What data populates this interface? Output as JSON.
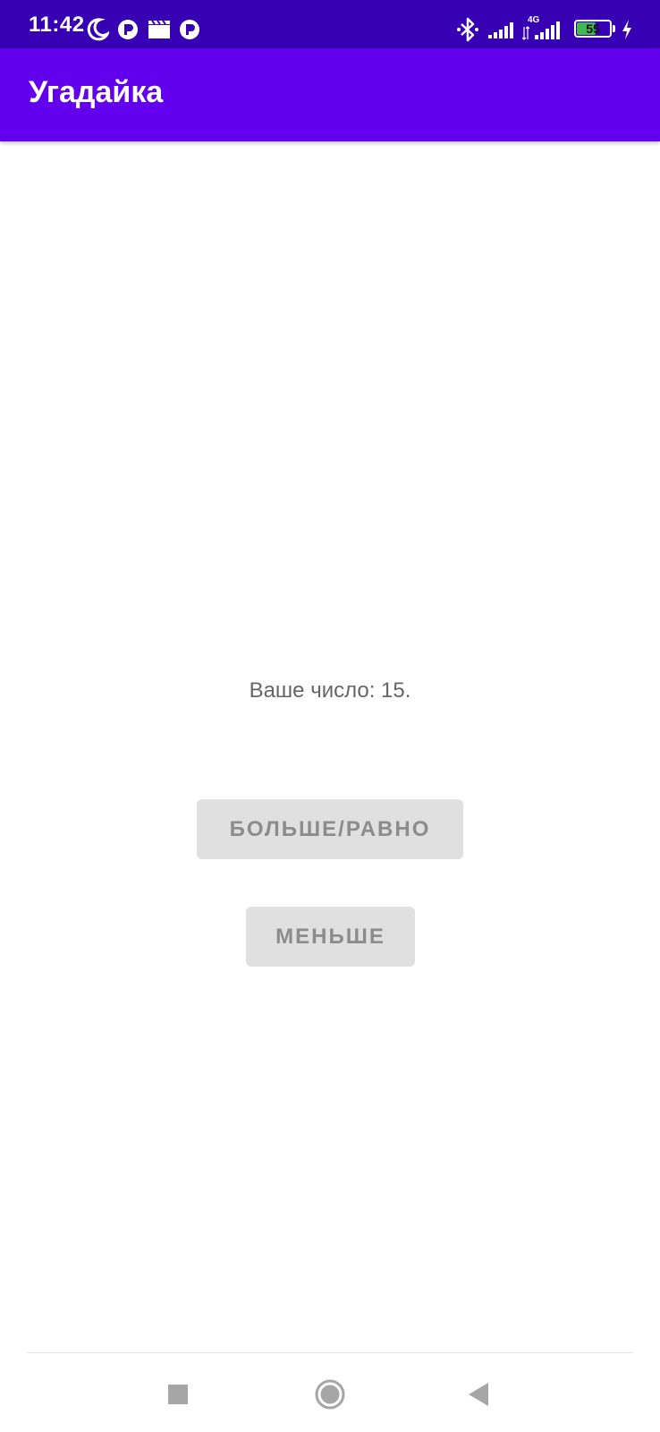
{
  "status_bar": {
    "time": "11:42",
    "network_label": "4G",
    "battery_level": "55",
    "background_color": "#3700b3",
    "icons": [
      "moon-icon",
      "app-notification-icon",
      "clapperboard-icon",
      "app-notification-icon",
      "bluetooth-icon",
      "signal-icon",
      "signal-4g-icon",
      "battery-icon",
      "charging-icon"
    ]
  },
  "app_bar": {
    "title": "Угадайка",
    "color": "#6200ee"
  },
  "main": {
    "number_text": "Ваше число: 15.",
    "more_equal_button": "БОЛЬШЕ/РАВНО",
    "less_button": "МЕНЬШЕ"
  },
  "nav_bar": {
    "buttons": [
      "recents-square-icon",
      "home-circle-icon",
      "back-triangle-icon"
    ]
  }
}
